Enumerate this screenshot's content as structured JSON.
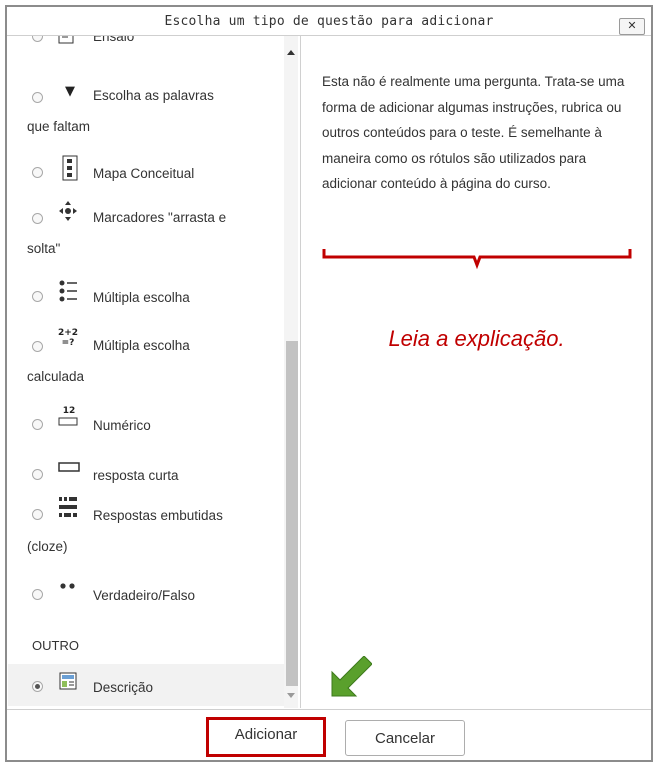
{
  "dialog": {
    "title": "Escolha um tipo de questão para adicionar",
    "close_label": "✕"
  },
  "question_types": [
    {
      "label": "Ensaio",
      "icon": "essay-icon"
    },
    {
      "label_line1": "Escolha as palavras",
      "label_line2": "que faltam",
      "icon": "dropdown-arrow-icon"
    },
    {
      "label": "Mapa Conceitual",
      "icon": "concept-map-icon"
    },
    {
      "label_line1": "Marcadores \"arrasta e",
      "label_line2": "solta\"",
      "icon": "drag-drop-icon"
    },
    {
      "label": "Múltipla escolha",
      "icon": "multiple-choice-icon"
    },
    {
      "label_line1": "Múltipla escolha",
      "label_line2": "calculada",
      "icon": "calculated-multichoice-icon",
      "icon_text_top": "2+2",
      "icon_text_bottom": "=?"
    },
    {
      "label": "Numérico",
      "icon": "numeric-icon",
      "icon_text": "12"
    },
    {
      "label": "resposta curta",
      "icon": "short-answer-icon"
    },
    {
      "label_line1": "Respostas embutidas",
      "label_line2": "(cloze)",
      "icon": "cloze-icon"
    },
    {
      "label": "Verdadeiro/Falso",
      "icon": "true-false-icon"
    }
  ],
  "other_section": {
    "heading": "OUTRO",
    "item_label": "Descrição",
    "item_icon": "description-icon",
    "selected": true
  },
  "description_text": "Esta não é realmente uma pergunta. Trata-se uma forma de adicionar algumas instruções, rubrica ou outros conteúdos para o teste. É semelhante à maneira como os rótulos são utilizados para adicionar conteúdo à página do curso.",
  "annotation": {
    "text": "Leia a explicação.",
    "color": "#c00000",
    "arrow_color": "#5aa02c"
  },
  "footer": {
    "add_label": "Adicionar",
    "cancel_label": "Cancelar"
  }
}
